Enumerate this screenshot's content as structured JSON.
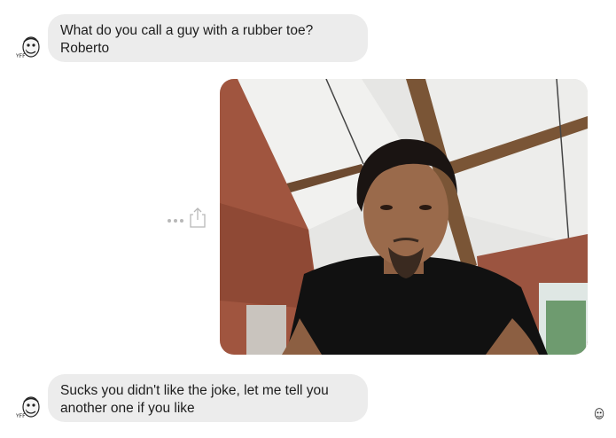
{
  "messages": [
    {
      "sender": "other",
      "lines": [
        "What do you call a guy with a rubber toe?",
        "Roberto"
      ]
    },
    {
      "sender": "me",
      "type": "photo",
      "description": "selfie photo attachment"
    },
    {
      "sender": "other",
      "lines": [
        "Sucks you didn't like the joke, let me tell you",
        "another one if you like"
      ]
    }
  ],
  "icons": {
    "avatar": "meme-face-avatar-icon",
    "more": "more-options-icon",
    "share": "share-icon",
    "read_receipt": "read-receipt-avatar-icon"
  },
  "avatar_caption": "YFF",
  "colors": {
    "bubble_bg": "#ececec",
    "text": "#1d1d1d",
    "icon_gray": "#b8b8b8"
  }
}
